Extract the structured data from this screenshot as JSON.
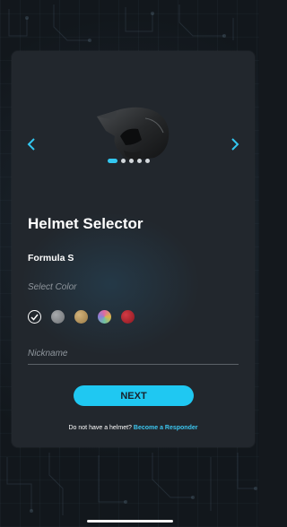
{
  "carousel": {
    "total_slides": 5,
    "active_slide": 1,
    "prev_icon": "chevron-left-icon",
    "next_icon": "chevron-right-icon"
  },
  "selector": {
    "title": "Helmet Selector",
    "model_name": "Formula S",
    "color_label": "Select Color",
    "colors": [
      {
        "name": "selected-check",
        "color": "#ffffff",
        "selected": true
      },
      {
        "name": "gray",
        "color": "#8a8d90"
      },
      {
        "name": "gold",
        "color": "#b5915a"
      },
      {
        "name": "iridescent",
        "color": "#c48bb8"
      },
      {
        "name": "red",
        "color": "#b3222c"
      }
    ],
    "nickname_placeholder": "Nickname",
    "next_label": "NEXT"
  },
  "footer": {
    "text": "Do not have a helmet?",
    "link_label": "Become a Responder"
  },
  "theme": {
    "accent": "#1fc8f2",
    "card_bg": "#22272d",
    "page_bg": "#14181d"
  }
}
